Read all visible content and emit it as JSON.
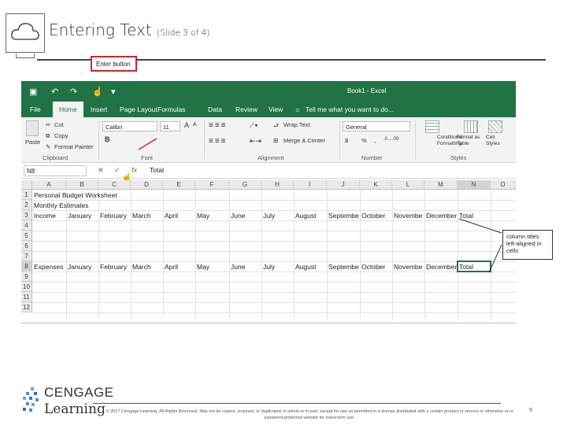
{
  "slide": {
    "title": "Entering Text",
    "subtitle": "(Slide 3 of 4)",
    "page_number": "9",
    "copyright": "© 2017 Cengage Learning. All Rights Reserved. May not be copied, scanned, or duplicated, in whole or in part, except for use as permitted in a license distributed with a certain product or service or otherwise on a password-protected website for classroom use.",
    "logo": {
      "line1": "CENGAGE",
      "line2": "Learning"
    }
  },
  "excel": {
    "window_title": "Book1 - Excel",
    "menu": [
      "File",
      "Home",
      "Insert",
      "Page Layout",
      "Formulas",
      "Data",
      "Review",
      "View"
    ],
    "tell_me": "Tell me what you want to do...",
    "clipboard": {
      "paste": "Paste",
      "cut": "Cut",
      "copy": "Copy",
      "format_painter": "Format Painter",
      "group": "Clipboard"
    },
    "font": {
      "name": "Calibri",
      "size": "11",
      "group": "Font"
    },
    "alignment": {
      "wrap": "Wrap Text",
      "merge": "Merge & Center",
      "group": "Alignment"
    },
    "number": {
      "format": "General",
      "currency": "$",
      "percent": "%",
      "group": "Number"
    },
    "styles": {
      "conditional": "Conditional Formatting",
      "table": "Format as Table",
      "cell": "Cell Styles",
      "group": "Styles"
    },
    "enter_button_label": "Enter button",
    "namebox": "N8",
    "formula_value": "Total",
    "columns": [
      "A",
      "B",
      "C",
      "D",
      "E",
      "F",
      "G",
      "H",
      "I",
      "J",
      "K",
      "L",
      "M",
      "N",
      "O"
    ],
    "rows": [
      "1",
      "2",
      "3",
      "4",
      "5",
      "6",
      "7",
      "8",
      "9",
      "10",
      "11",
      "12"
    ],
    "cells": {
      "a1": "Personal Budget Worksheet",
      "a2": "Monthly Estimates",
      "row3": [
        "Income",
        "January",
        "February",
        "March",
        "April",
        "May",
        "June",
        "July",
        "August",
        "Septembe",
        "October",
        "Novembe",
        "December",
        "Total"
      ],
      "row8": [
        "Expenses",
        "January",
        "February",
        "March",
        "April",
        "May",
        "June",
        "July",
        "August",
        "Septembe",
        "October",
        "Novembe",
        "December",
        "Total"
      ]
    }
  },
  "callout": "column titles left-aligned in cells",
  "colors": {
    "excel_green": "#217346",
    "highlight_red": "#c8282e"
  }
}
